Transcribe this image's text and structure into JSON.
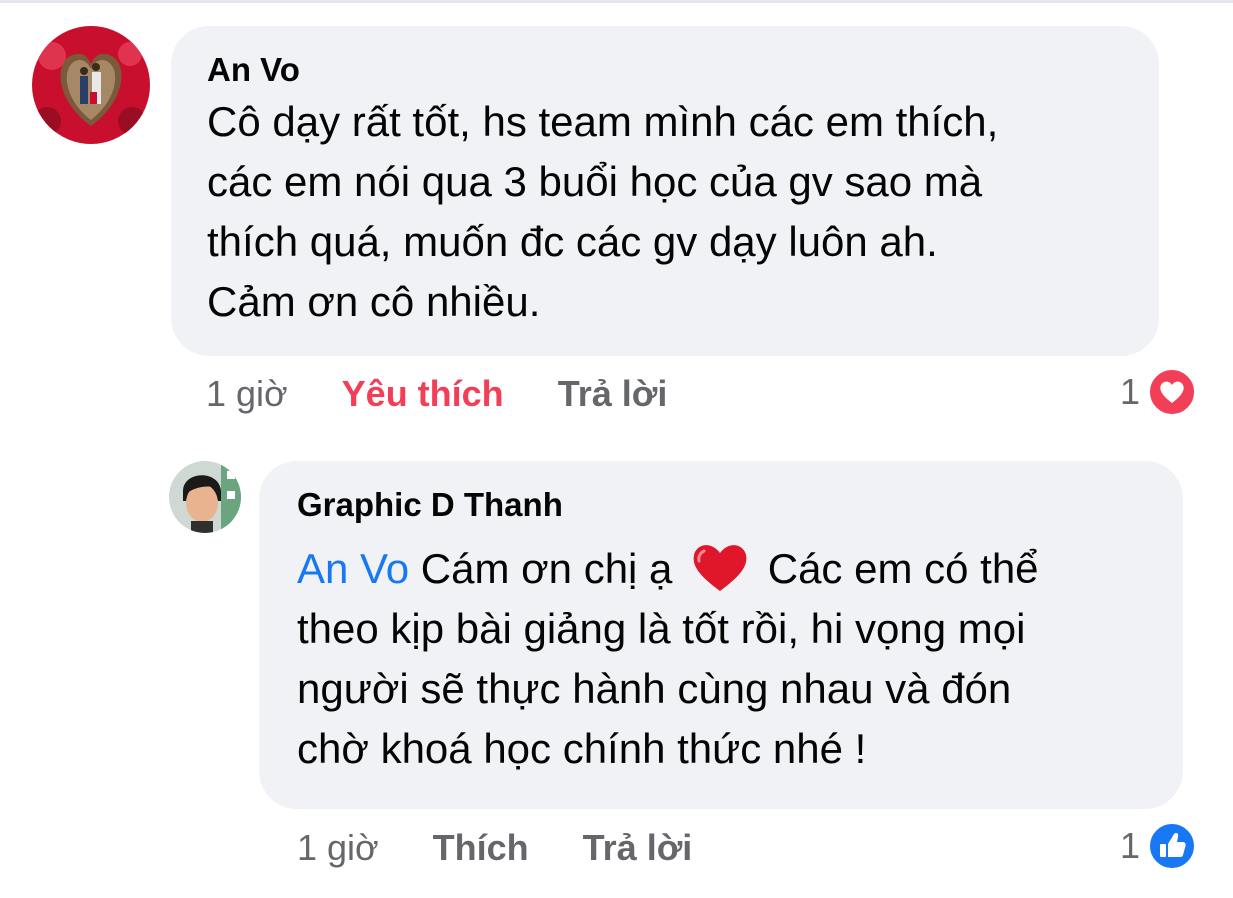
{
  "comments": [
    {
      "author": "An Vo",
      "lines": [
        "Cô dạy rất tốt, hs team mình các em thích,",
        "các em nói qua 3 buổi học của gv sao mà",
        "thích quá, muốn đc các gv dạy luôn ah.",
        "Cảm ơn cô nhiều."
      ],
      "time": "1 giờ",
      "like_label": "Yêu thích",
      "reply_label": "Trả lời",
      "reaction_count": "1",
      "reaction_icon": "love-reaction-icon",
      "reaction_color": "#f33e58"
    },
    {
      "author": "Graphic D Thanh",
      "mention": "An Vo",
      "first_line_text": " Cám ơn chị ạ ",
      "first_line_tail": " Các em có thể",
      "lines": [
        "theo kịp bài giảng là tốt rồi, hi vọng mọi",
        "người sẽ thực hành cùng nhau và đón",
        "chờ khoá học chính thức nhé !"
      ],
      "time": "1 giờ",
      "like_label": "Thích",
      "reply_label": "Trả lời",
      "reaction_count": "1",
      "reaction_icon": "like-reaction-icon",
      "reaction_color": "#1877f2"
    }
  ],
  "colors": {
    "bubble": "#f0f2f5",
    "text": "#050505",
    "secondary": "#65676b",
    "mention": "#1877f2",
    "love": "#f33e58"
  }
}
